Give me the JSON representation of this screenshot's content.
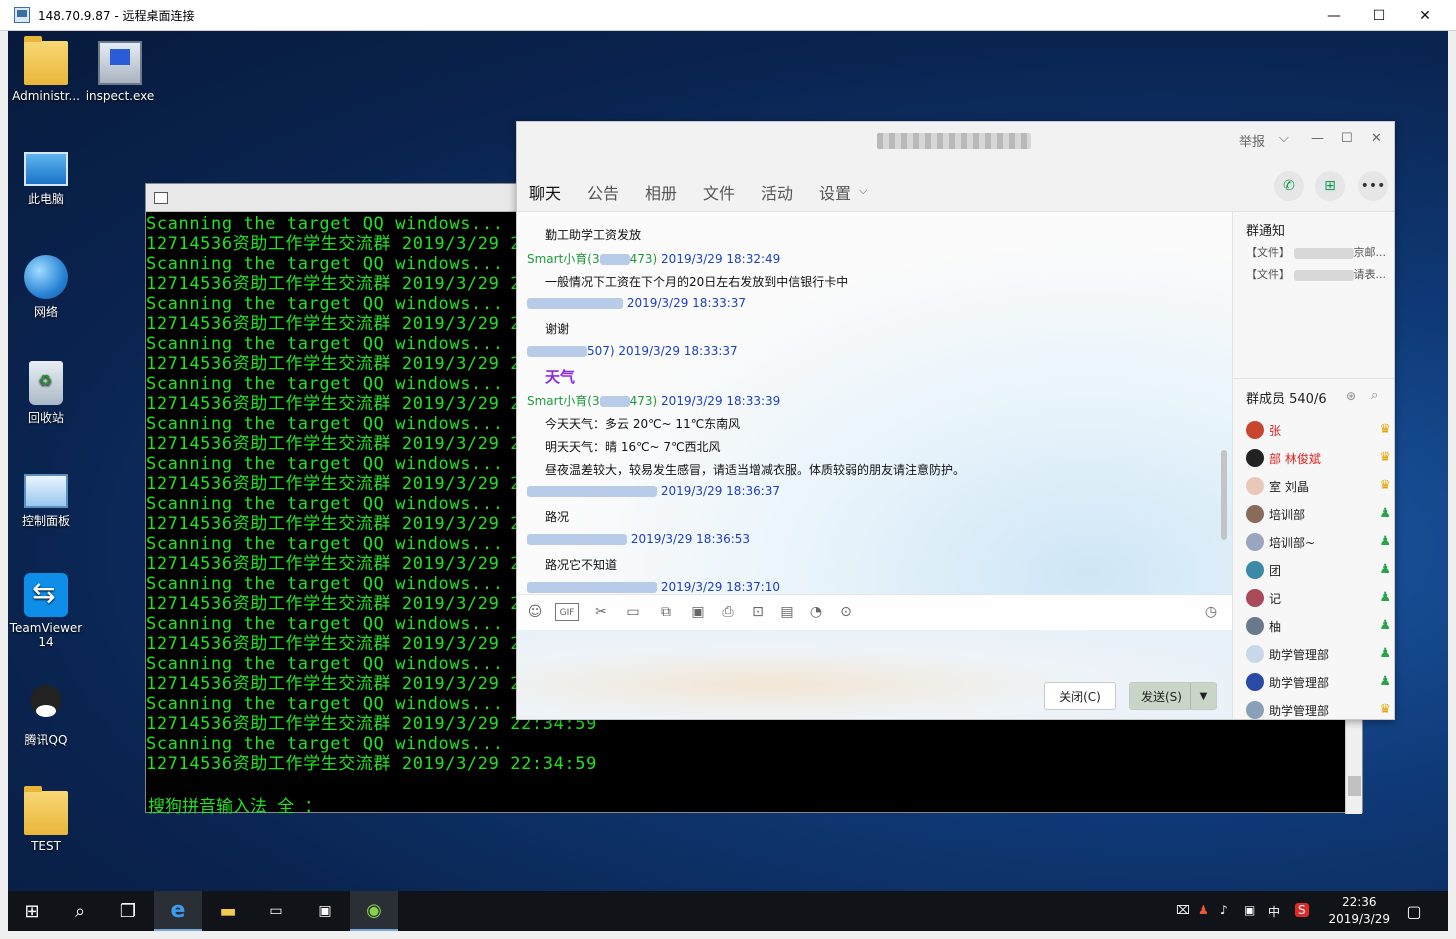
{
  "rdp": {
    "title": "148.70.9.87 - 远程桌面连接",
    "min": "—",
    "max": "☐",
    "close": "✕"
  },
  "desktop_icons": [
    {
      "label": "Administr...",
      "icon": "user-folder-icon"
    },
    {
      "label": "inspect.exe",
      "icon": "inspect-icon"
    },
    {
      "label": "此电脑",
      "icon": "computer-icon"
    },
    {
      "label": "网络",
      "icon": "network-icon"
    },
    {
      "label": "回收站",
      "icon": "recycle-bin-icon"
    },
    {
      "label": "控制面板",
      "icon": "control-panel-icon"
    },
    {
      "label": "TeamViewer 14",
      "icon": "teamviewer-icon"
    },
    {
      "label": "腾讯QQ",
      "icon": "qq-icon"
    },
    {
      "label": "TEST",
      "icon": "folder-icon"
    }
  ],
  "console": {
    "scan_line": "Scanning the target QQ windows...",
    "result_line": "12714536资助工作学生交流群 2019/3/29 22:34:59",
    "ime_line": "搜狗拼音输入法 全 ："
  },
  "qq": {
    "title_buttons": {
      "report": "举报"
    },
    "tabs": [
      "聊天",
      "公告",
      "相册",
      "文件",
      "活动",
      "设置"
    ],
    "messages": [
      {
        "header_prefix": "",
        "header_suffix": "",
        "time": "",
        "text": "勤工助学工资发放"
      },
      {
        "header_prefix": "Smart小育(3",
        "header_suffix": "473)",
        "time": "2019/3/29 18:32:49",
        "text": "一般情况下工资在下个月的20日左右发放到中信银行卡中"
      },
      {
        "header_prefix": "",
        "header_suffix": "",
        "time": "2019/3/29 18:33:37",
        "text": "谢谢"
      },
      {
        "header_prefix": "",
        "header_suffix": "507)",
        "time": "2019/3/29 18:33:37",
        "text": "天气"
      },
      {
        "header_prefix": "Smart小育(3",
        "header_suffix": "473)",
        "time": "2019/3/29 18:33:39",
        "lines": [
          "今天天气：多云 20℃~ 11℃东南风",
          "明天天气：晴 16℃~ 7℃西北风",
          "昼夜温差较大，较易发生感冒，请适当增减衣服。体质较弱的朋友请注意防护。"
        ]
      },
      {
        "header_prefix": "",
        "header_suffix": "",
        "time": "2019/3/29 18:36:37",
        "text": "路况"
      },
      {
        "header_prefix": "",
        "header_suffix": "",
        "time": "2019/3/29 18:36:53",
        "text": "路况它不知道"
      },
      {
        "header_prefix": "",
        "header_suffix": "",
        "time": "2019/3/29 18:37:10",
        "text": ""
      }
    ],
    "buttons": {
      "close": "关闭(C)",
      "send": "发送(S)"
    },
    "side": {
      "notice_title": "群通知",
      "notices": [
        "【文件】",
        "【文件】"
      ],
      "notice_tails": [
        "京邮...",
        "请表..."
      ],
      "members_title": "群成员 540/6",
      "members": [
        {
          "name": "张",
          "red": true
        },
        {
          "name": "部 林俊斌",
          "red": true
        },
        {
          "name": "室 刘晶",
          "red": false
        },
        {
          "name": "培训部",
          "red": false
        },
        {
          "name": "培训部~",
          "red": false
        },
        {
          "name": "团",
          "red": false
        },
        {
          "name": "记",
          "red": false
        },
        {
          "name": "柚",
          "red": false
        },
        {
          "name": "助学管理部",
          "red": false
        },
        {
          "name": "助学管理部",
          "red": false
        },
        {
          "name": "助学管理部",
          "red": false
        }
      ]
    }
  },
  "taskbar": {
    "clock_time": "22:36",
    "clock_date": "2019/3/29",
    "ime": "中"
  }
}
